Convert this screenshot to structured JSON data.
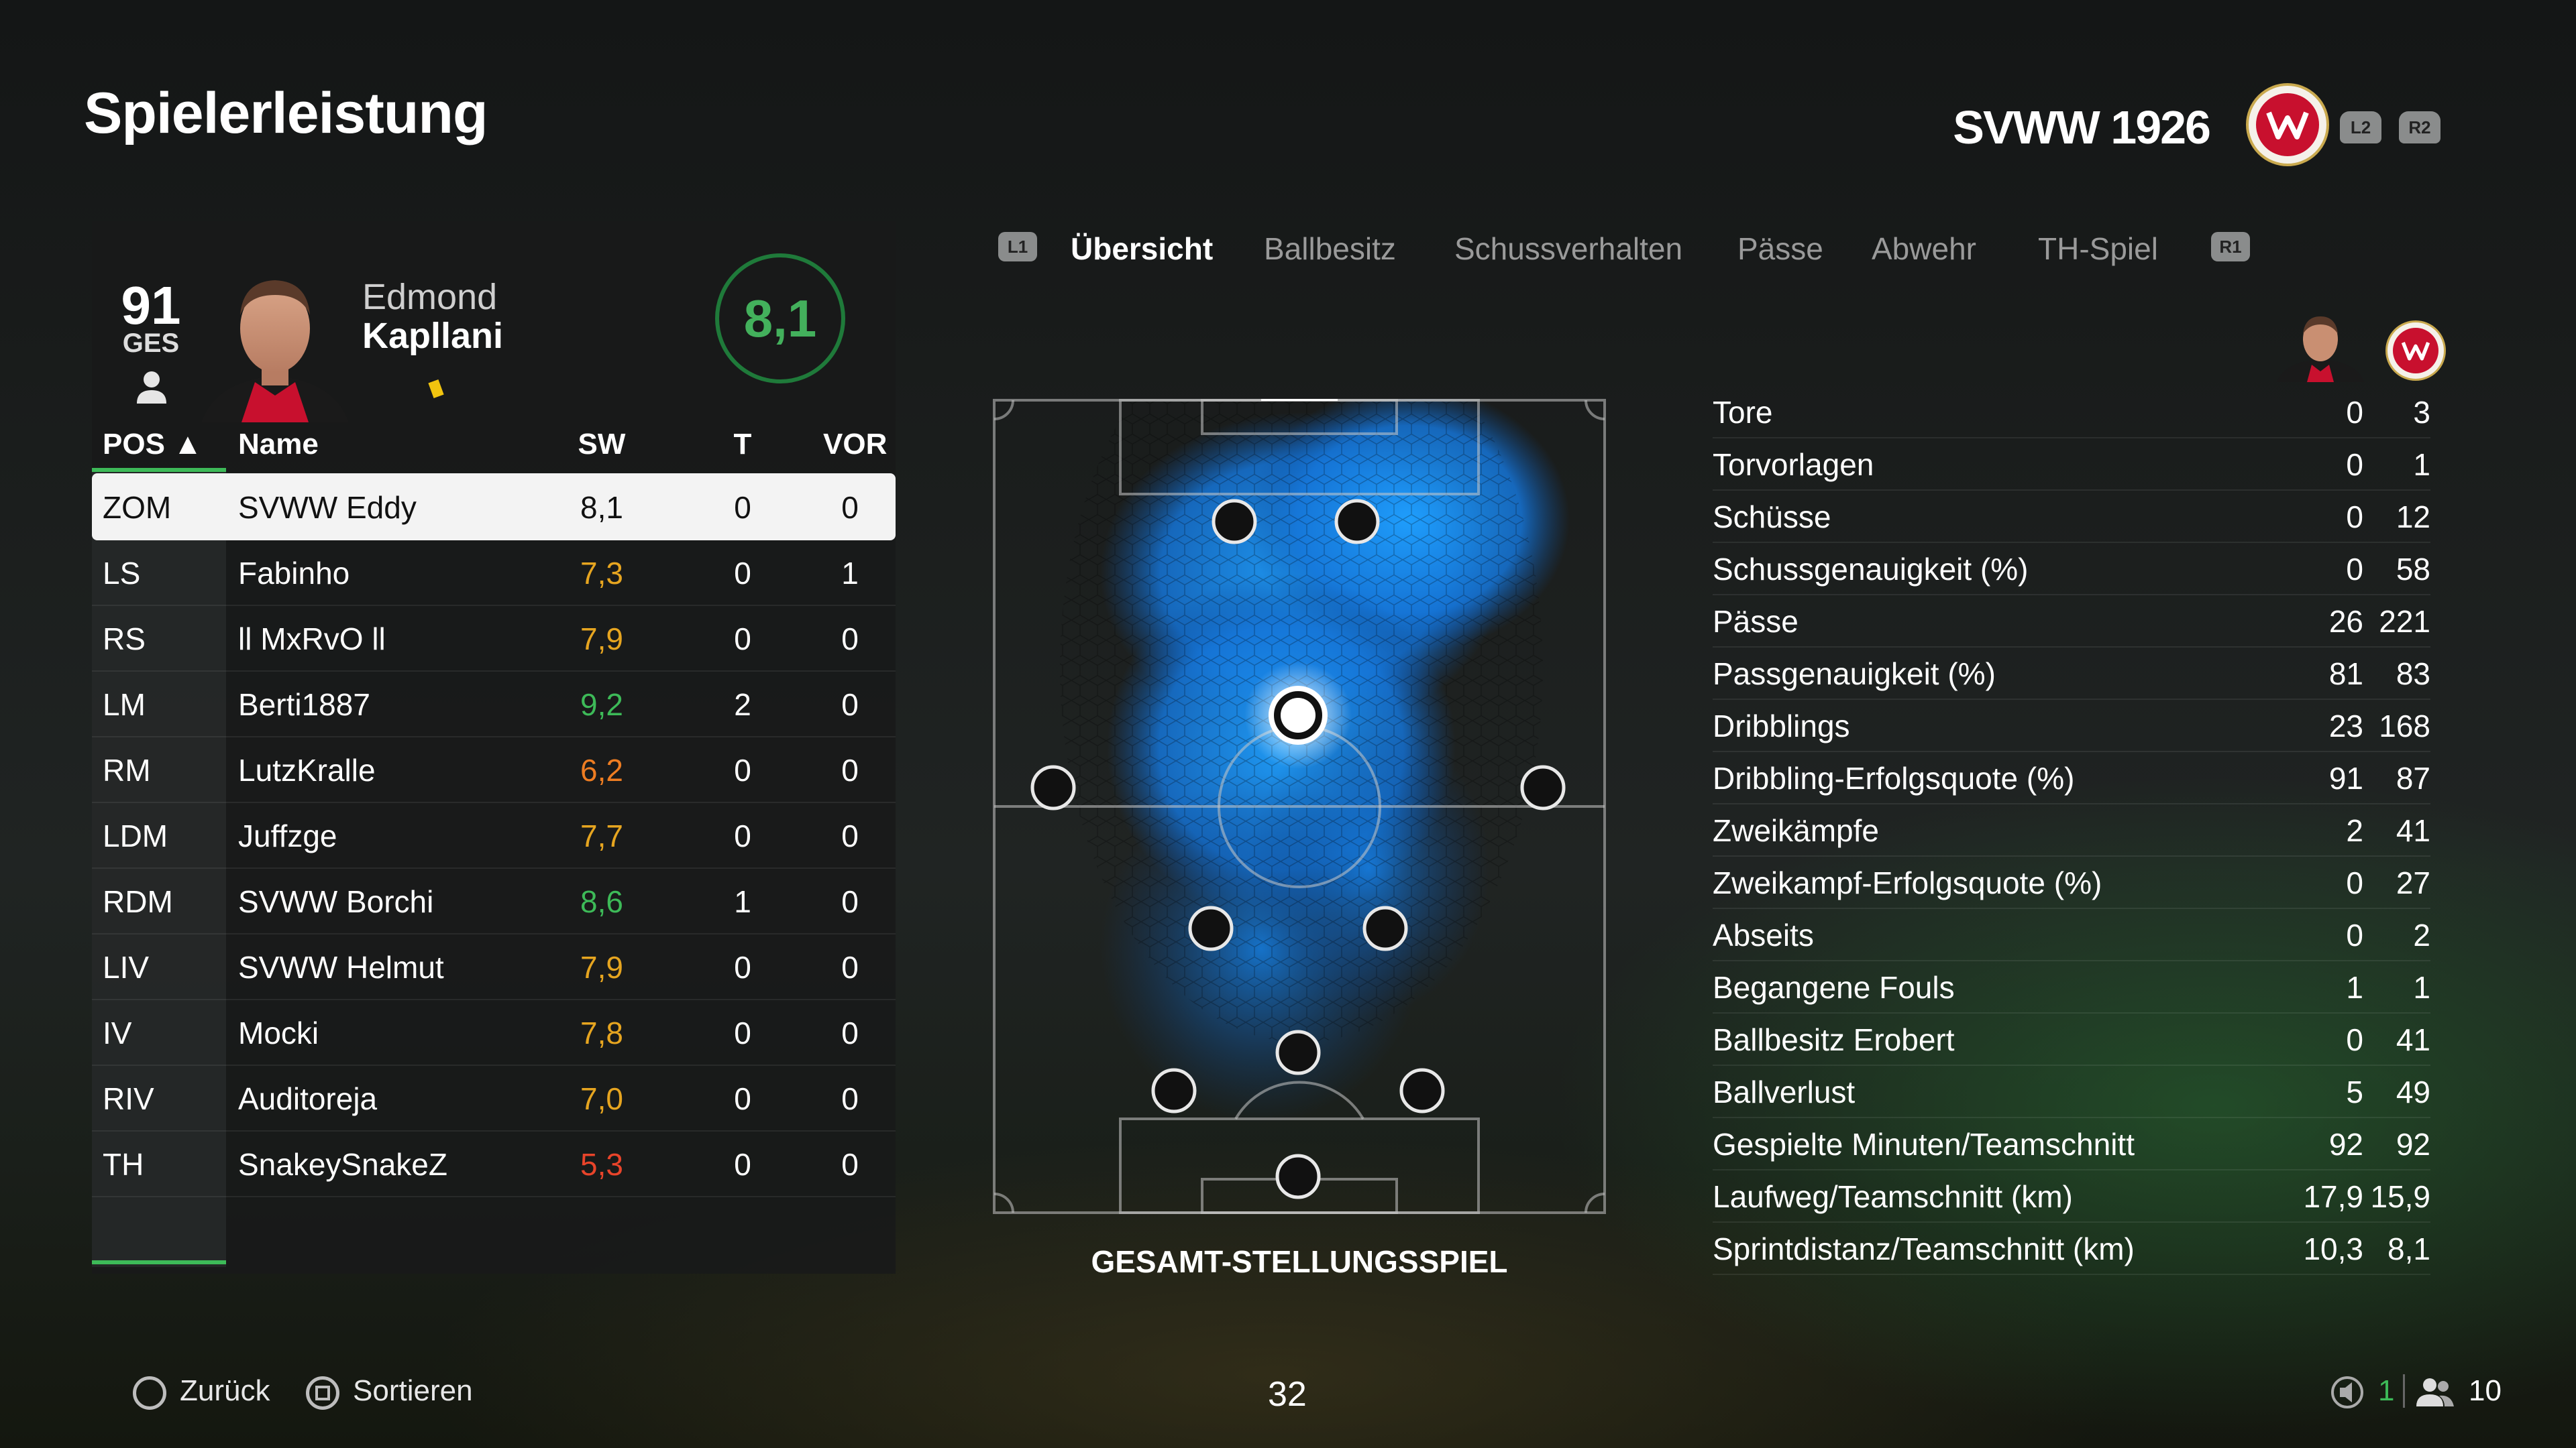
{
  "header": {
    "title": "Spielerleistung",
    "team": "SVWW 1926",
    "shoulder_left": "L2",
    "shoulder_right": "R2"
  },
  "player": {
    "overall": "91",
    "overall_label": "GES",
    "first_name": "Edmond",
    "last_name": "Kapllani",
    "rating": "8,1"
  },
  "table": {
    "headers": {
      "pos": "POS ▲",
      "name": "Name",
      "sw": "SW",
      "t": "T",
      "vor": "VOR"
    },
    "rows": [
      {
        "pos": "ZOM",
        "name": "SVWW Eddy",
        "sw": "8,1",
        "t": "0",
        "vor": "0",
        "color": "#111111"
      },
      {
        "pos": "LS",
        "name": "Fabinho",
        "sw": "7,3",
        "t": "0",
        "vor": "1",
        "color": "#e6a520"
      },
      {
        "pos": "RS",
        "name": "ll MxRvO ll",
        "sw": "7,9",
        "t": "0",
        "vor": "0",
        "color": "#e6a520"
      },
      {
        "pos": "LM",
        "name": "Berti1887",
        "sw": "9,2",
        "t": "2",
        "vor": "0",
        "color": "#3dba58"
      },
      {
        "pos": "RM",
        "name": "LutzKralle",
        "sw": "6,2",
        "t": "0",
        "vor": "0",
        "color": "#ee7d22"
      },
      {
        "pos": "LDM",
        "name": "Juffzge",
        "sw": "7,7",
        "t": "0",
        "vor": "0",
        "color": "#e6a520"
      },
      {
        "pos": "RDM",
        "name": "SVWW Borchi",
        "sw": "8,6",
        "t": "1",
        "vor": "0",
        "color": "#3dba58"
      },
      {
        "pos": "LIV",
        "name": "SVWW Helmut",
        "sw": "7,9",
        "t": "0",
        "vor": "0",
        "color": "#e6a520"
      },
      {
        "pos": "IV",
        "name": "Mocki",
        "sw": "7,8",
        "t": "0",
        "vor": "0",
        "color": "#e6a520"
      },
      {
        "pos": "RIV",
        "name": "Auditoreja",
        "sw": "7,0",
        "t": "0",
        "vor": "0",
        "color": "#e6a520"
      },
      {
        "pos": "TH",
        "name": "SnakeySnakeZ",
        "sw": "5,3",
        "t": "0",
        "vor": "0",
        "color": "#e8442a"
      }
    ]
  },
  "tabs": {
    "left_button": "L1",
    "right_button": "R1",
    "items": [
      "Übersicht",
      "Ballbesitz",
      "Schussverhalten",
      "Pässe",
      "Abwehr",
      "TH-Spiel"
    ],
    "active": 0
  },
  "pitch": {
    "caption": "GESAMT-STELLUNGSSPIEL"
  },
  "stats": [
    {
      "label": "Tore",
      "player": "0",
      "team": "3"
    },
    {
      "label": "Torvorlagen",
      "player": "0",
      "team": "1"
    },
    {
      "label": "Schüsse",
      "player": "0",
      "team": "12"
    },
    {
      "label": "Schussgenauigkeit (%)",
      "player": "0",
      "team": "58"
    },
    {
      "label": "Pässe",
      "player": "26",
      "team": "221"
    },
    {
      "label": "Passgenauigkeit (%)",
      "player": "81",
      "team": "83"
    },
    {
      "label": "Dribblings",
      "player": "23",
      "team": "168"
    },
    {
      "label": "Dribbling-Erfolgsquote (%)",
      "player": "91",
      "team": "87"
    },
    {
      "label": "Zweikämpfe",
      "player": "2",
      "team": "41"
    },
    {
      "label": "Zweikampf-Erfolgsquote (%)",
      "player": "0",
      "team": "27"
    },
    {
      "label": "Abseits",
      "player": "0",
      "team": "2"
    },
    {
      "label": "Begangene Fouls",
      "player": "1",
      "team": "1"
    },
    {
      "label": "Ballbesitz Erobert",
      "player": "0",
      "team": "41"
    },
    {
      "label": "Ballverlust",
      "player": "5",
      "team": "49"
    },
    {
      "label": "Gespielte Minuten/Teamschnitt",
      "player": "92",
      "team": "92"
    },
    {
      "label": "Laufweg/Teamschnitt (km)",
      "player": "17,9",
      "team": "15,9"
    },
    {
      "label": "Sprintdistanz/Teamschnitt (km)",
      "player": "10,3",
      "team": "8,1"
    }
  ],
  "footer": {
    "back": "Zurück",
    "sort": "Sortieren",
    "page": "32",
    "voice_count": "1",
    "player_count": "10"
  },
  "colors": {
    "accent_green": "#3dba58",
    "crest_red": "#c8102e",
    "heat_blue": "#1a8cff"
  }
}
